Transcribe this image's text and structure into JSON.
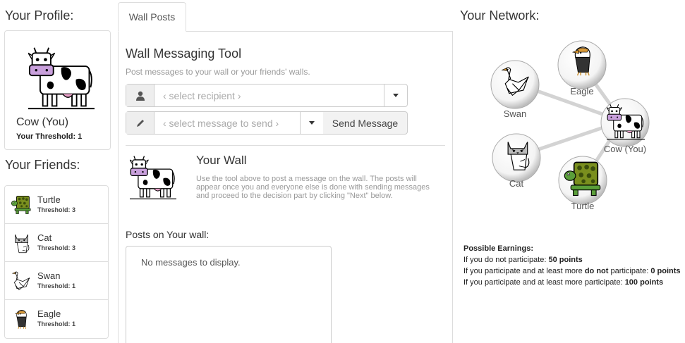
{
  "profile": {
    "title": "Your Profile:",
    "name": "Cow (You)",
    "threshold": "Your Threshold: 1"
  },
  "friends": {
    "title": "Your Friends:",
    "items": [
      {
        "name": "Turtle",
        "threshold": "Threshold: 3",
        "icon": "turtle-icon"
      },
      {
        "name": "Cat",
        "threshold": "Threshold: 3",
        "icon": "cat-icon"
      },
      {
        "name": "Swan",
        "threshold": "Threshold: 1",
        "icon": "swan-icon"
      },
      {
        "name": "Eagle",
        "threshold": "Threshold: 1",
        "icon": "eagle-icon"
      }
    ]
  },
  "tabs": {
    "wall_posts": "Wall Posts"
  },
  "tool": {
    "title": "Wall Messaging Tool",
    "subtitle": "Post messages to your wall or your friends' walls.",
    "recipient_placeholder": "‹ select recipient ›",
    "message_placeholder": "‹ select message to send ›",
    "send_label": "Send Message"
  },
  "wall": {
    "title": "Your Wall",
    "description": "Use the tool above to post a message on the wall. The posts will appear once you and everyone else is done with sending messages and proceed to the decision part by clicking \"Next\" below.",
    "posts_label": "Posts on Your wall:",
    "empty_text": "No messages to display."
  },
  "network": {
    "title": "Your Network:",
    "nodes": {
      "eagle": "Eagle",
      "swan": "Swan",
      "cow": "Cow (You)",
      "cat": "Cat",
      "turtle": "Turtle"
    }
  },
  "earnings": {
    "title": "Possible Earnings:",
    "line1_text": "If you do not participate: ",
    "line1_value": "50 points",
    "line2_text_a": "If you participate and at least more ",
    "line2_emph": "do not",
    "line2_text_b": " participate: ",
    "line2_value": "0 points",
    "line3_text": "If you participate and at least more participate: ",
    "line3_value": "100 points"
  },
  "colors": {
    "cow_muzzle": "#c9a0dc",
    "turtle_green": "#6b8e23",
    "network_edge": "#d3d3d3"
  }
}
